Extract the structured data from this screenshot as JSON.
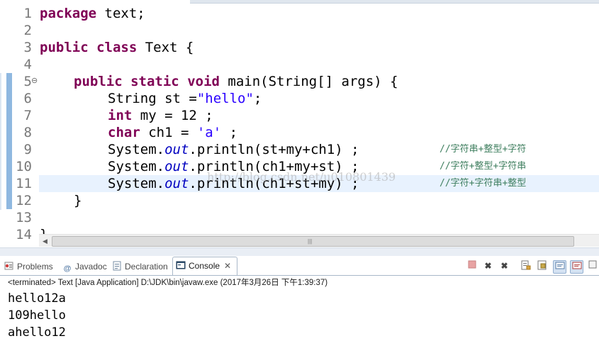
{
  "editor": {
    "lines": [
      {
        "n": "1"
      },
      {
        "n": "2"
      },
      {
        "n": "3"
      },
      {
        "n": "4"
      },
      {
        "n": "5"
      },
      {
        "n": "6"
      },
      {
        "n": "7"
      },
      {
        "n": "8"
      },
      {
        "n": "9"
      },
      {
        "n": "10"
      },
      {
        "n": "11"
      },
      {
        "n": "12"
      },
      {
        "n": "13"
      },
      {
        "n": "14"
      }
    ],
    "code": {
      "l1_kw": "package",
      "l1_rest": " text;",
      "l3_kw1": "public",
      "l3_kw2": "class",
      "l3_rest": " Text {",
      "l5_kw1": "public",
      "l5_kw2": "static",
      "l5_kw3": "void",
      "l5_rest": " main(String[] args) {",
      "l6_pre": "String st =",
      "l6_str": "\"hello\"",
      "l6_post": ";",
      "l7_kw": "int",
      "l7_rest": " my = 12 ;",
      "l8_kw": "char",
      "l8_mid": " ch1 = ",
      "l8_str": "'a'",
      "l8_post": " ;",
      "l9_pre": "System.",
      "l9_fld": "out",
      "l9_post": ".println(st+my+ch1) ;",
      "l10_pre": "System.",
      "l10_fld": "out",
      "l10_post": ".println(ch1+my+st) ;",
      "l11_pre": "System.",
      "l11_fld": "out",
      "l11_post": ".println(ch1+st+my) ;",
      "l12": "}",
      "l14": "}"
    },
    "comments": {
      "l9": "//字符串+整型+字符",
      "l10": "//字符+整型+字符串",
      "l11": "//字符+字符串+整型"
    },
    "watermark": "http://blog.csdn.net/u010801439",
    "fold_glyph": "⊖",
    "scroll_grip": "|||"
  },
  "panel": {
    "tabs": {
      "problems": "Problems",
      "javadoc": "Javadoc",
      "declaration": "Declaration",
      "console": "Console"
    },
    "console_close": "✕",
    "status": "<terminated> Text [Java Application] D:\\JDK\\bin\\javaw.exe (2017年3月26日 下午1:39:37)",
    "output": [
      "hello12a",
      "109hello",
      "ahello12"
    ]
  },
  "icons": {
    "problems": "problems-icon",
    "javadoc": "javadoc-icon",
    "declaration": "declaration-icon",
    "console": "console-icon"
  },
  "colors": {
    "keyword": "#7f0055",
    "string": "#2a00ff",
    "field": "#0000c0",
    "comment": "#3f7f5f",
    "current_line": "#e8f2fe"
  }
}
